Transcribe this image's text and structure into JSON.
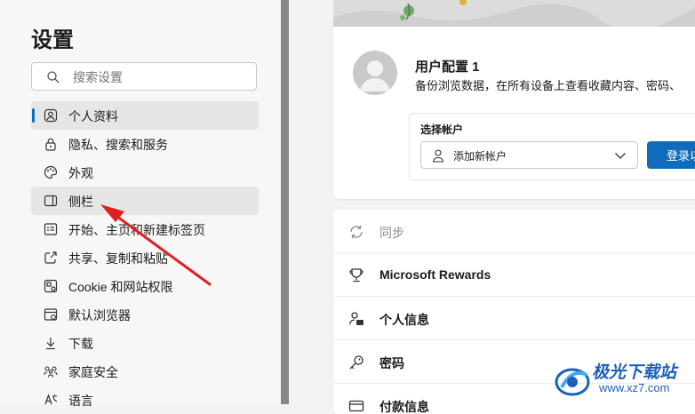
{
  "sidebar": {
    "title": "设置",
    "search_placeholder": "搜索设置",
    "items": [
      {
        "label": "个人资料",
        "icon": "profile-icon"
      },
      {
        "label": "隐私、搜索和服务",
        "icon": "lock-icon"
      },
      {
        "label": "外观",
        "icon": "palette-icon"
      },
      {
        "label": "侧栏",
        "icon": "sidebar-icon"
      },
      {
        "label": "开始、主页和新建标签页",
        "icon": "home-grid-icon"
      },
      {
        "label": "共享、复制和粘贴",
        "icon": "share-icon"
      },
      {
        "label": "Cookie 和网站权限",
        "icon": "cookie-icon"
      },
      {
        "label": "默认浏览器",
        "icon": "browser-icon"
      },
      {
        "label": "下载",
        "icon": "download-icon"
      },
      {
        "label": "家庭安全",
        "icon": "family-icon"
      },
      {
        "label": "语言",
        "icon": "language-icon"
      }
    ],
    "active_index": 0,
    "highlighted_index": 3
  },
  "profile": {
    "name": "用户配置 1",
    "description": "备份浏览数据，在所有设备上查看收藏内容、密码、"
  },
  "account": {
    "label": "选择帐户",
    "select_value": "添加新帐户",
    "login_button": "登录以"
  },
  "rows": [
    {
      "label": "同步",
      "icon": "sync-icon",
      "disabled": true
    },
    {
      "label": "Microsoft Rewards",
      "icon": "trophy-icon",
      "disabled": false
    },
    {
      "label": "个人信息",
      "icon": "person-card-icon",
      "disabled": false
    },
    {
      "label": "密码",
      "icon": "key-icon",
      "disabled": false
    },
    {
      "label": "付款信息",
      "icon": "card-icon",
      "disabled": false
    }
  ],
  "watermark": {
    "name": "极光下载站",
    "url": "www.xz7.com"
  },
  "colors": {
    "accent": "#0f6cbd",
    "arrow": "#e02020",
    "watermark": "#1e5fb8"
  }
}
